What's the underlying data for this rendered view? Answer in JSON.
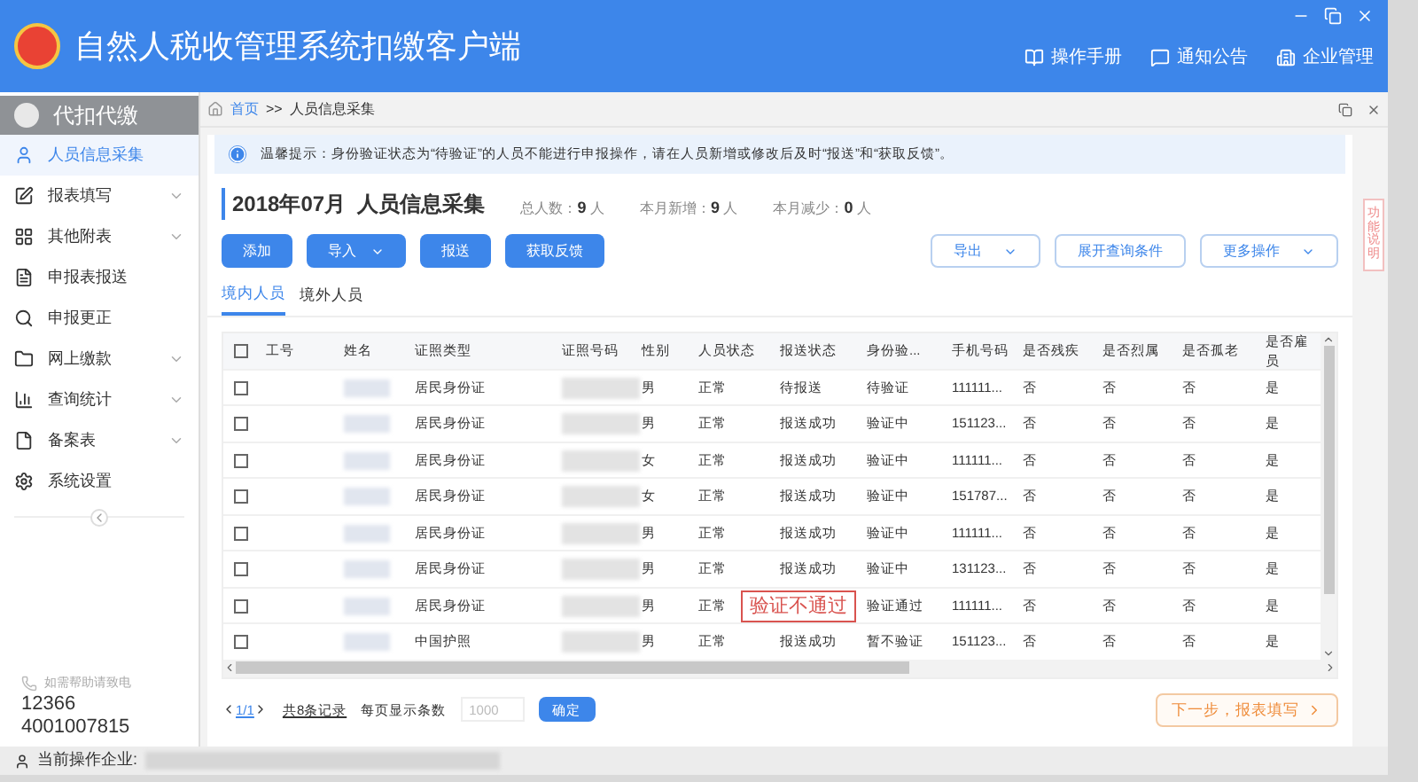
{
  "window": {
    "title": "自然人税收管理系统扣缴客户端",
    "header_links": [
      "操作手册",
      "通知公告",
      "企业管理"
    ]
  },
  "sidebar": {
    "header": "代扣代缴",
    "items": [
      {
        "label": "人员信息采集",
        "selected": true,
        "expandable": false
      },
      {
        "label": "报表填写",
        "selected": false,
        "expandable": true
      },
      {
        "label": "其他附表",
        "selected": false,
        "expandable": true
      },
      {
        "label": "申报表报送",
        "selected": false,
        "expandable": false
      },
      {
        "label": "申报更正",
        "selected": false,
        "expandable": false
      },
      {
        "label": "网上缴款",
        "selected": false,
        "expandable": true
      },
      {
        "label": "查询统计",
        "selected": false,
        "expandable": true
      },
      {
        "label": "备案表",
        "selected": false,
        "expandable": true
      },
      {
        "label": "系统设置",
        "selected": false,
        "expandable": false
      }
    ],
    "hotline_label": "如需帮助请致电",
    "phones": [
      "12366",
      "4001007815"
    ]
  },
  "breadcrumb": [
    "首页",
    ">>",
    "人员信息采集"
  ],
  "notice": "温馨提示：身份验证状态为“待验证”的人员不能进行申报操作，请在人员新增或修改后及时“报送”和“获取反馈”。",
  "page_header": {
    "title": "2018年07月  人员信息采集",
    "stats": [
      {
        "label": "总人数：",
        "value": "9",
        "unit": "人"
      },
      {
        "label": "本月新增：",
        "value": "9",
        "unit": "人"
      },
      {
        "label": "本月减少：",
        "value": "0",
        "unit": "人"
      }
    ]
  },
  "left_buttons": [
    {
      "label": "添加",
      "dropdown": false
    },
    {
      "label": "导入",
      "dropdown": true
    },
    {
      "label": "报送",
      "dropdown": false
    },
    {
      "label": "获取反馈",
      "dropdown": false
    }
  ],
  "right_buttons": [
    {
      "label": "导出",
      "dropdown": true
    },
    {
      "label": "展开查询条件",
      "dropdown": false
    },
    {
      "label": "更多操作",
      "dropdown": true
    }
  ],
  "tabs": [
    {
      "label": "境内人员",
      "selected": true
    },
    {
      "label": "境外人员",
      "selected": false
    }
  ],
  "table": {
    "select_all_checked": false,
    "columns": [
      "工号",
      "姓名",
      "证照类型",
      "证照号码",
      "性别",
      "人员状态",
      "报送状态",
      "身份验...",
      "手机号码",
      "是否残疾",
      "是否烈属",
      "是否孤老",
      "是否雇员"
    ],
    "rows": [
      {
        "checked": false,
        "id_type": "居民身份证",
        "gender": "男",
        "status": "正常",
        "report": "待报送",
        "verify": "待验证",
        "phone": "111111...",
        "flags": [
          "否",
          "否",
          "否",
          "是"
        ]
      },
      {
        "checked": false,
        "id_type": "居民身份证",
        "gender": "男",
        "status": "正常",
        "report": "报送成功",
        "verify": "验证中",
        "phone": "151123...",
        "flags": [
          "否",
          "否",
          "否",
          "是"
        ]
      },
      {
        "checked": false,
        "id_type": "居民身份证",
        "gender": "女",
        "status": "正常",
        "report": "报送成功",
        "verify": "验证中",
        "phone": "111111...",
        "flags": [
          "否",
          "否",
          "否",
          "是"
        ]
      },
      {
        "checked": false,
        "id_type": "居民身份证",
        "gender": "女",
        "status": "正常",
        "report": "报送成功",
        "verify": "验证中",
        "phone": "151787...",
        "flags": [
          "否",
          "否",
          "否",
          "是"
        ]
      },
      {
        "checked": false,
        "id_type": "居民身份证",
        "gender": "男",
        "status": "正常",
        "report": "报送成功",
        "verify": "验证中",
        "phone": "111111...",
        "flags": [
          "否",
          "否",
          "否",
          "是"
        ]
      },
      {
        "checked": false,
        "id_type": "居民身份证",
        "gender": "男",
        "status": "正常",
        "report": "报送成功",
        "verify": "验证中",
        "phone": "131123...",
        "flags": [
          "否",
          "否",
          "否",
          "是"
        ]
      },
      {
        "checked": false,
        "id_type": "居民身份证",
        "gender": "男",
        "status": "正常",
        "annotation": "验证不通过",
        "verify": "验证通过",
        "phone": "111111...",
        "flags": [
          "否",
          "否",
          "否",
          "是"
        ]
      },
      {
        "checked": false,
        "id_type": "中国护照",
        "gender": "男",
        "status": "正常",
        "report": "报送成功",
        "verify": "暂不验证",
        "phone": "151123...",
        "flags": [
          "否",
          "否",
          "否",
          "是"
        ]
      }
    ]
  },
  "pagination": {
    "page": "1/1",
    "total": "共8条记录",
    "page_size_label": "每页显示条数",
    "page_size": "1000",
    "confirm": "确定"
  },
  "next_button": "下一步，报表填写",
  "side_panel": "功能说明",
  "status_bar": {
    "label": "当前操作企业:"
  }
}
